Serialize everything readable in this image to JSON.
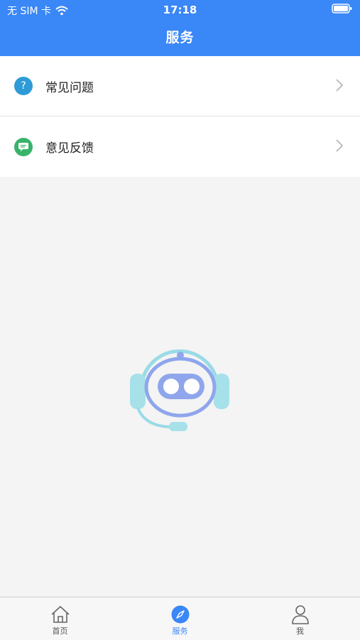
{
  "status_bar": {
    "carrier": "无 SIM 卡",
    "time": "17:18"
  },
  "header": {
    "title": "服务"
  },
  "menu": [
    {
      "label": "常见问题",
      "icon": "question-icon",
      "icon_color": "#2e9bd6"
    },
    {
      "label": "意见反馈",
      "icon": "feedback-icon",
      "icon_color": "#39b36b"
    }
  ],
  "tabbar": {
    "items": [
      {
        "label": "首页",
        "icon": "home-icon",
        "active": false
      },
      {
        "label": "服务",
        "icon": "compass-icon",
        "active": true
      },
      {
        "label": "我",
        "icon": "user-icon",
        "active": false
      }
    ]
  },
  "colors": {
    "primary": "#3a87f7",
    "background": "#f4f4f4"
  }
}
